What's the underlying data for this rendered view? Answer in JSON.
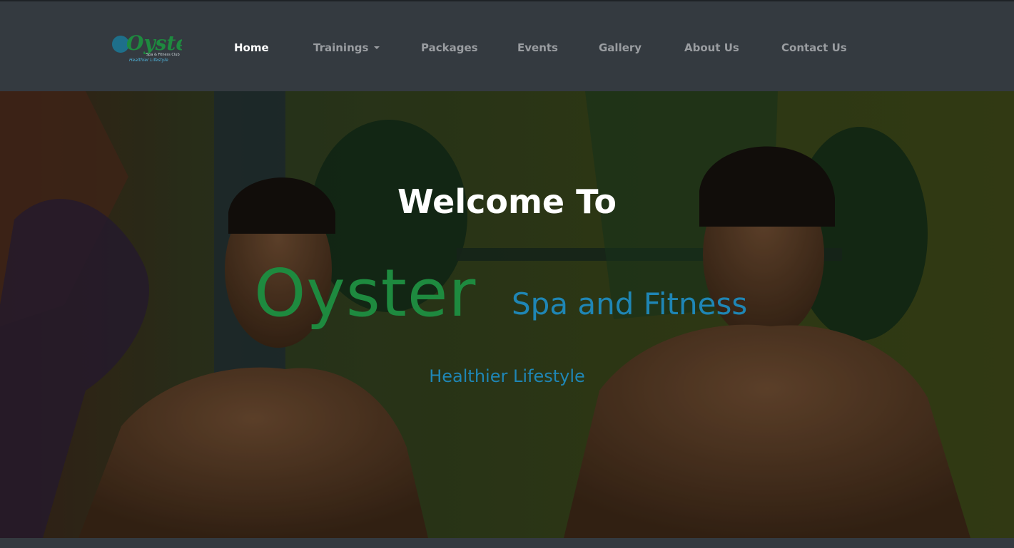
{
  "nav": {
    "logo": {
      "name": "Oyster",
      "small_text": "Spa & Fitness Club",
      "tagline": "Healthier Lifestyle"
    },
    "items": [
      {
        "label": "Home",
        "active": true
      },
      {
        "label": "Trainings",
        "dropdown": true
      },
      {
        "label": "Packages"
      },
      {
        "label": "Events"
      },
      {
        "label": "Gallery"
      },
      {
        "label": "About Us"
      },
      {
        "label": "Contact Us"
      }
    ]
  },
  "hero": {
    "welcome": "Welcome To",
    "brand_name": "Oyster",
    "brand_sub": "Spa and Fitness",
    "tagline": "Healthier Lifestyle"
  },
  "colors": {
    "navbar_bg": "#343a40",
    "nav_active": "#ffffff",
    "nav_inactive": "#9a9da1",
    "brand_green": "#1e8a3f",
    "brand_blue": "#1f86b5"
  }
}
